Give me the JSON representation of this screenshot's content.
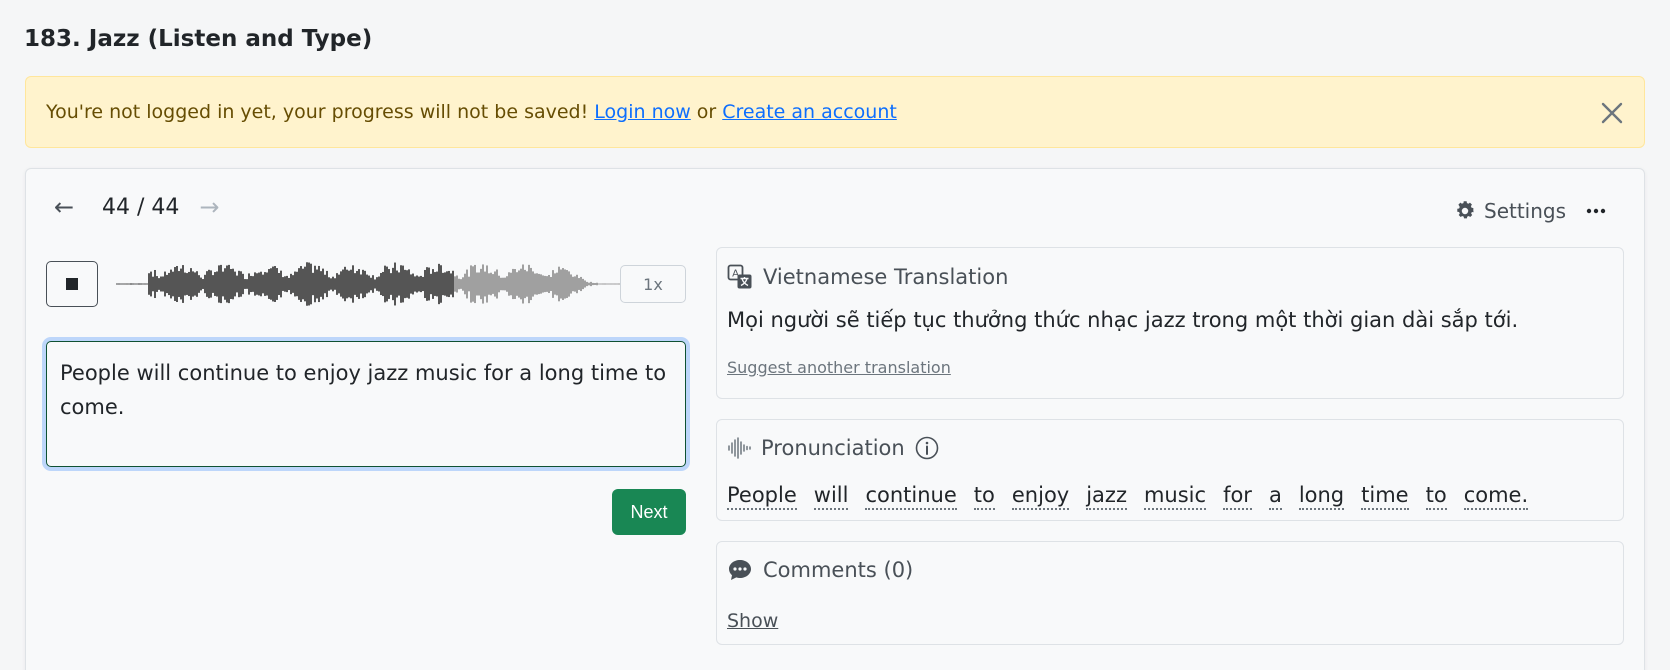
{
  "page": {
    "title": "183. Jazz (Listen and Type)"
  },
  "alert": {
    "message": "You're not logged in yet, your progress will not be saved!",
    "login_link": "Login now",
    "separator": "or",
    "signup_link": "Create an account"
  },
  "player": {
    "counter": "44 / 44",
    "prev_arrow": "←",
    "next_arrow": "→",
    "speed": "1x",
    "settings_label": "Settings",
    "progress": 0.65
  },
  "answer": {
    "value": "People will continue to enjoy jazz music for a long time to come."
  },
  "actions": {
    "next_label": "Next"
  },
  "translation": {
    "heading": "Vietnamese Translation",
    "text": "Mọi người sẽ tiếp tục thưởng thức nhạc jazz trong một thời gian dài sắp tới.",
    "suggest_link": "Suggest another translation"
  },
  "pronunciation": {
    "heading": "Pronunciation",
    "words": [
      "People",
      "will",
      "continue",
      "to",
      "enjoy",
      "jazz",
      "music",
      "for",
      "a",
      "long",
      "time",
      "to",
      "come."
    ]
  },
  "comments": {
    "heading": "Comments (0)",
    "show_link": "Show"
  },
  "colors": {
    "alert_bg": "#fff3cd",
    "link": "#0d6efd",
    "next_button": "#198754",
    "wave_played": "#555555",
    "wave_unplayed": "#a0a0a0"
  }
}
